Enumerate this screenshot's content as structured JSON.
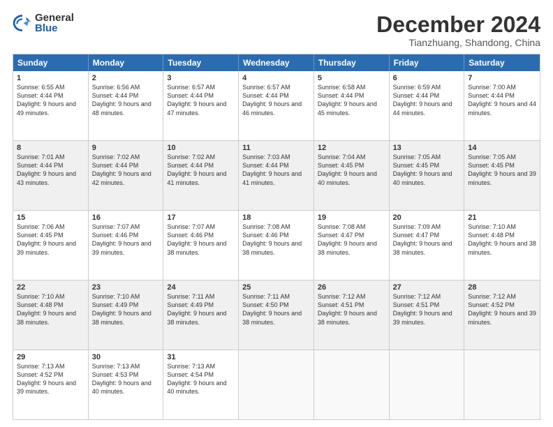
{
  "logo": {
    "general": "General",
    "blue": "Blue"
  },
  "title": "December 2024",
  "location": "Tianzhuang, Shandong, China",
  "days": [
    "Sunday",
    "Monday",
    "Tuesday",
    "Wednesday",
    "Thursday",
    "Friday",
    "Saturday"
  ],
  "rows": [
    [
      {
        "day": "1",
        "rise": "6:55 AM",
        "set": "4:44 PM",
        "daylight": "9 hours and 49 minutes."
      },
      {
        "day": "2",
        "rise": "6:56 AM",
        "set": "4:44 PM",
        "daylight": "9 hours and 48 minutes."
      },
      {
        "day": "3",
        "rise": "6:57 AM",
        "set": "4:44 PM",
        "daylight": "9 hours and 47 minutes."
      },
      {
        "day": "4",
        "rise": "6:57 AM",
        "set": "4:44 PM",
        "daylight": "9 hours and 46 minutes."
      },
      {
        "day": "5",
        "rise": "6:58 AM",
        "set": "4:44 PM",
        "daylight": "9 hours and 45 minutes."
      },
      {
        "day": "6",
        "rise": "6:59 AM",
        "set": "4:44 PM",
        "daylight": "9 hours and 44 minutes."
      },
      {
        "day": "7",
        "rise": "7:00 AM",
        "set": "4:44 PM",
        "daylight": "9 hours and 44 minutes."
      }
    ],
    [
      {
        "day": "8",
        "rise": "7:01 AM",
        "set": "4:44 PM",
        "daylight": "9 hours and 43 minutes."
      },
      {
        "day": "9",
        "rise": "7:02 AM",
        "set": "4:44 PM",
        "daylight": "9 hours and 42 minutes."
      },
      {
        "day": "10",
        "rise": "7:02 AM",
        "set": "4:44 PM",
        "daylight": "9 hours and 41 minutes."
      },
      {
        "day": "11",
        "rise": "7:03 AM",
        "set": "4:44 PM",
        "daylight": "9 hours and 41 minutes."
      },
      {
        "day": "12",
        "rise": "7:04 AM",
        "set": "4:45 PM",
        "daylight": "9 hours and 40 minutes."
      },
      {
        "day": "13",
        "rise": "7:05 AM",
        "set": "4:45 PM",
        "daylight": "9 hours and 40 minutes."
      },
      {
        "day": "14",
        "rise": "7:05 AM",
        "set": "4:45 PM",
        "daylight": "9 hours and 39 minutes."
      }
    ],
    [
      {
        "day": "15",
        "rise": "7:06 AM",
        "set": "4:45 PM",
        "daylight": "9 hours and 39 minutes."
      },
      {
        "day": "16",
        "rise": "7:07 AM",
        "set": "4:46 PM",
        "daylight": "9 hours and 39 minutes."
      },
      {
        "day": "17",
        "rise": "7:07 AM",
        "set": "4:46 PM",
        "daylight": "9 hours and 38 minutes."
      },
      {
        "day": "18",
        "rise": "7:08 AM",
        "set": "4:46 PM",
        "daylight": "9 hours and 38 minutes."
      },
      {
        "day": "19",
        "rise": "7:08 AM",
        "set": "4:47 PM",
        "daylight": "9 hours and 38 minutes."
      },
      {
        "day": "20",
        "rise": "7:09 AM",
        "set": "4:47 PM",
        "daylight": "9 hours and 38 minutes."
      },
      {
        "day": "21",
        "rise": "7:10 AM",
        "set": "4:48 PM",
        "daylight": "9 hours and 38 minutes."
      }
    ],
    [
      {
        "day": "22",
        "rise": "7:10 AM",
        "set": "4:48 PM",
        "daylight": "9 hours and 38 minutes."
      },
      {
        "day": "23",
        "rise": "7:10 AM",
        "set": "4:49 PM",
        "daylight": "9 hours and 38 minutes."
      },
      {
        "day": "24",
        "rise": "7:11 AM",
        "set": "4:49 PM",
        "daylight": "9 hours and 38 minutes."
      },
      {
        "day": "25",
        "rise": "7:11 AM",
        "set": "4:50 PM",
        "daylight": "9 hours and 38 minutes."
      },
      {
        "day": "26",
        "rise": "7:12 AM",
        "set": "4:51 PM",
        "daylight": "9 hours and 38 minutes."
      },
      {
        "day": "27",
        "rise": "7:12 AM",
        "set": "4:51 PM",
        "daylight": "9 hours and 39 minutes."
      },
      {
        "day": "28",
        "rise": "7:12 AM",
        "set": "4:52 PM",
        "daylight": "9 hours and 39 minutes."
      }
    ],
    [
      {
        "day": "29",
        "rise": "7:13 AM",
        "set": "4:52 PM",
        "daylight": "9 hours and 39 minutes."
      },
      {
        "day": "30",
        "rise": "7:13 AM",
        "set": "4:53 PM",
        "daylight": "9 hours and 40 minutes."
      },
      {
        "day": "31",
        "rise": "7:13 AM",
        "set": "4:54 PM",
        "daylight": "9 hours and 40 minutes."
      },
      null,
      null,
      null,
      null
    ]
  ],
  "row_alt": [
    false,
    true,
    false,
    true,
    false
  ]
}
